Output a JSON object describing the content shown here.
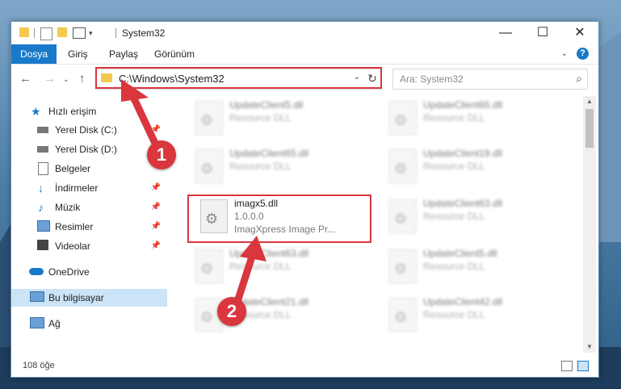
{
  "window": {
    "title": "System32"
  },
  "window_controls": {
    "minimize": "—",
    "maximize": "☐",
    "close": "✕"
  },
  "ribbon": {
    "tabs": [
      "Dosya",
      "Giriş",
      "Paylaş",
      "Görünüm"
    ],
    "help": "?"
  },
  "address": {
    "path": "C:\\Windows\\System32"
  },
  "search": {
    "placeholder": "Ara: System32"
  },
  "sidebar": {
    "quick_access": "Hızlı erişim",
    "items": [
      "Yerel Disk (C:)",
      "Yerel Disk (D:)",
      "Belgeler",
      "İndirmeler",
      "Müzik",
      "Resimler",
      "Videolar"
    ],
    "onedrive": "OneDrive",
    "this_pc": "Bu bilgisayar",
    "network": "Ağ"
  },
  "files": [
    {
      "name": "UpdateClient5.dll",
      "type": "Resource DLL"
    },
    {
      "name": "UpdateClient65.dll",
      "type": "Resource DLL"
    },
    {
      "name": "UpdateClient65.dll",
      "type": "Resource DLL"
    },
    {
      "name": "UpdateClient19.dll",
      "type": "Resource DLL"
    },
    {
      "name": "imagx5.dll",
      "version": "1.0.0.0",
      "description": "ImagXpress Image Pr..."
    },
    {
      "name": "UpdateClient63.dll",
      "type": "Resource DLL"
    },
    {
      "name": "UpdateClient63.dll",
      "type": "Resource DLL"
    },
    {
      "name": "UpdateClient5.dll",
      "type": "Resource DLL"
    },
    {
      "name": "UpdateClient21.dll",
      "type": "Resource DLL"
    },
    {
      "name": "UpdateClient42.dll",
      "type": "Resource DLL"
    }
  ],
  "status": {
    "count": "108 öğe"
  },
  "callouts": {
    "step1": "1",
    "step2": "2",
    "color": "#d9363e"
  },
  "colors": {
    "accent": "#1979ca",
    "selection": "#cce4f7",
    "folder": "#f4c94e"
  }
}
